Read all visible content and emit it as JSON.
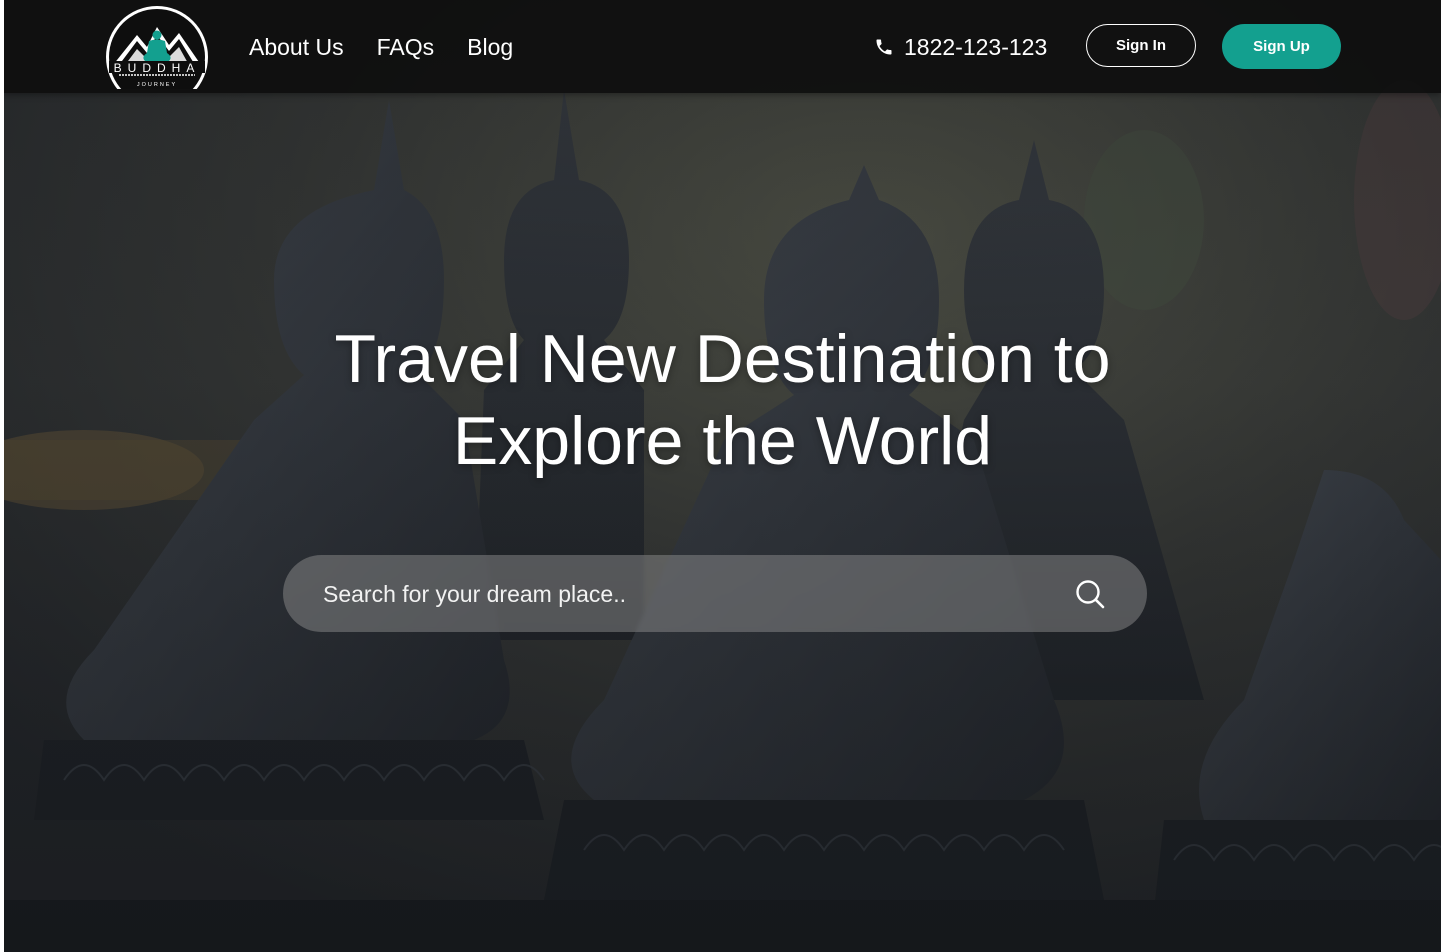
{
  "brand": {
    "logo_name": "BUDDHA",
    "logo_tagline": "JOURNEY",
    "accent_color": "#13a08f"
  },
  "nav": {
    "links": [
      "About Us",
      "FAQs",
      "Blog"
    ]
  },
  "contact": {
    "icon": "phone-icon",
    "phone": "1822-123-123"
  },
  "auth": {
    "sign_in": "Sign In",
    "sign_up": "Sign Up"
  },
  "hero": {
    "title_line1": "Travel New Destination to",
    "title_line2": "Explore the World",
    "search_placeholder": "Search for your dream place..",
    "search_icon": "search-icon"
  }
}
